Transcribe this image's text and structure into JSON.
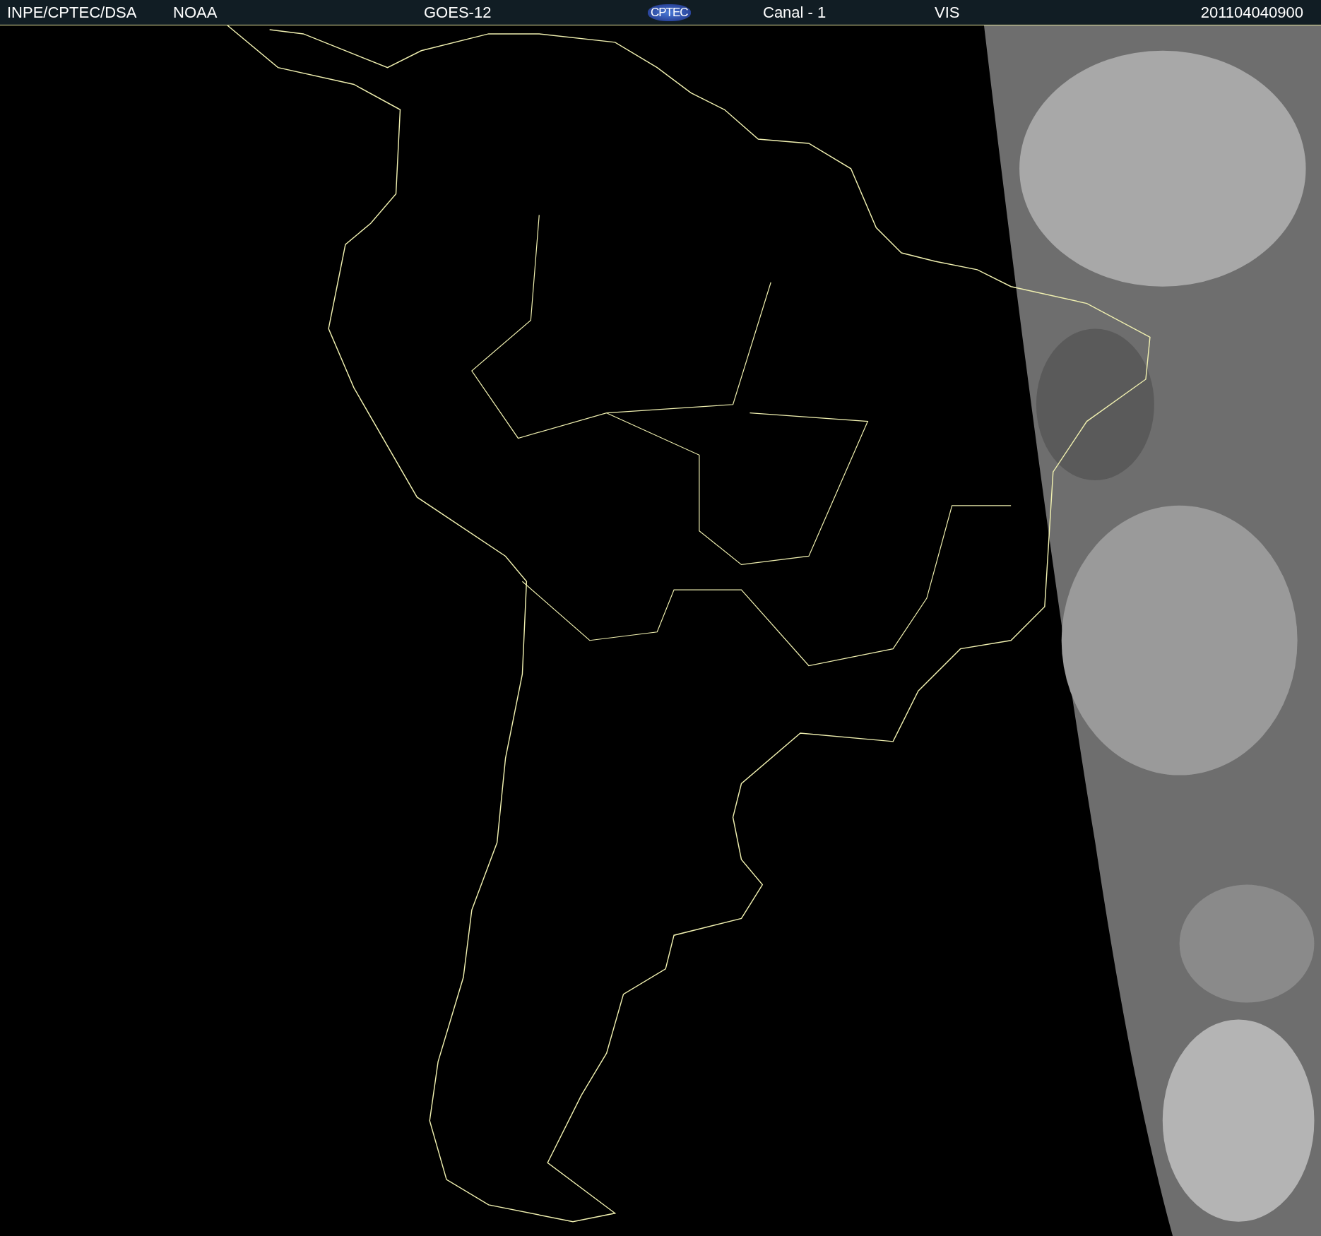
{
  "header": {
    "source": "INPE/CPTEC/DSA",
    "agency": "NOAA",
    "satellite": "GOES-12",
    "logo": "CPTEC",
    "channel": "Canal - 1",
    "band": "VIS",
    "timestamp": "201104040900"
  }
}
